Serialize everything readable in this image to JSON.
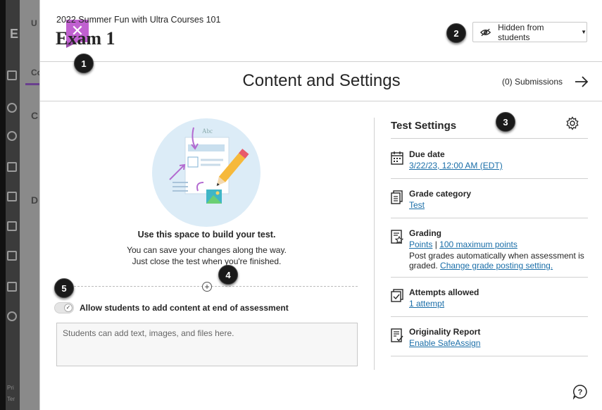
{
  "header": {
    "course_name": "2022 Summer Fun with Ultra Courses 101",
    "exam_title": "Exam 1",
    "visibility_label": "Hidden from students"
  },
  "content_bar": {
    "heading": "Content and Settings",
    "submissions_label": "(0) Submissions"
  },
  "builder": {
    "title": "Use this space to build your test.",
    "desc_line1": "You can save your changes along the way.",
    "desc_line2": "Just close the test when you're finished.",
    "allow_label": "Allow students to add content at end of assessment",
    "student_placeholder": "Students can add text, images, and files here.",
    "illustration_text": "Abc"
  },
  "settings": {
    "title": "Test Settings",
    "items": [
      {
        "icon": "calendar-icon",
        "title": "Due date",
        "value": "3/22/23, 12:00 AM (EDT)"
      },
      {
        "icon": "grade-category-icon",
        "title": "Grade category",
        "value": "Test"
      },
      {
        "icon": "grading-icon",
        "title": "Grading",
        "value": "Points",
        "separator": "|",
        "value2": "100 maximum points",
        "desc": "Post grades automatically when assessment is graded.",
        "link": "Change grade posting setting."
      },
      {
        "icon": "attempts-icon",
        "title": "Attempts allowed",
        "value": "1 attempt"
      },
      {
        "icon": "originality-icon",
        "title": "Originality Report",
        "value": "Enable SafeAssign"
      }
    ]
  },
  "callouts": [
    "1",
    "2",
    "3",
    "4",
    "5"
  ],
  "background": {
    "fragments": [
      "U",
      "E",
      "Co",
      "C",
      "D"
    ],
    "small_text_1": "Pri",
    "small_text_2": "Ter"
  },
  "colors": {
    "accent_purple": "#c060d0",
    "link_blue": "#1a6ea8",
    "callout_black": "#1a1a1a"
  }
}
